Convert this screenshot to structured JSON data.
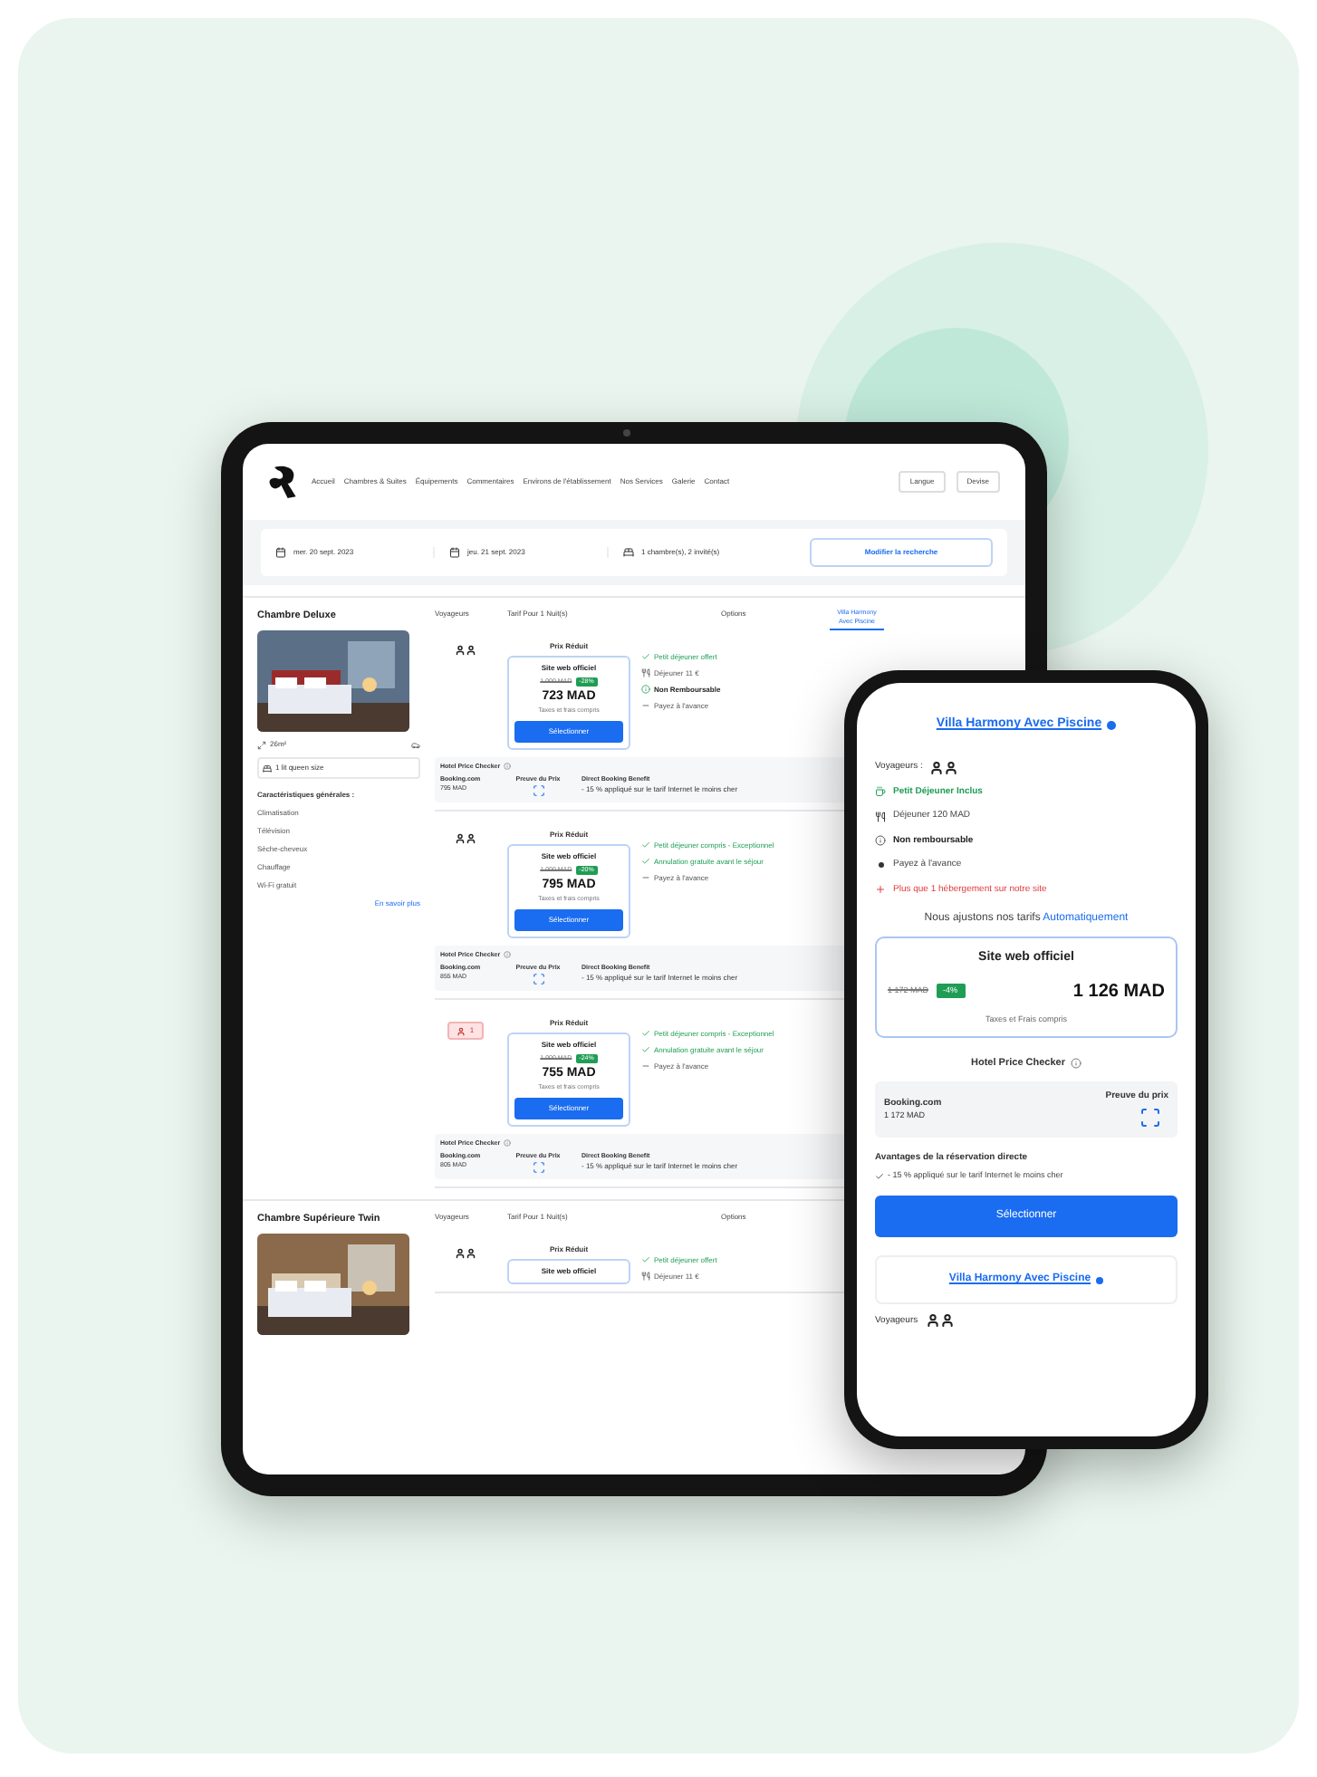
{
  "tablet": {
    "nav": [
      "Accueil",
      "Chambres & Suites",
      "Équipements",
      "Commentaires",
      "Environs de l'établissement",
      "Nos Services",
      "Galerie",
      "Contact"
    ],
    "header_buttons": [
      "Langue",
      "Devise"
    ],
    "search": {
      "check_in": "mer. 20 sept. 2023",
      "check_out": "jeu. 21 sept. 2023",
      "guests": "1 chambre(s), 2 invité(s)",
      "button": "Modifier la recherche"
    },
    "rooms": [
      {
        "name": "Chambre Deluxe",
        "size": "26m²",
        "beds": "1 lit queen size",
        "amenities_title": "Caractéristiques générales :",
        "amenities": [
          "Climatisation",
          "Télévision",
          "Sèche-cheveux",
          "Chauffage",
          "Wi-Fi gratuit"
        ],
        "more": "En savoir plus",
        "columns": [
          "Voyageurs",
          "Tarif Pour 1 Nuit(s)",
          "Options"
        ],
        "side_link": "Villa Harmony Avec Piscine",
        "rates": [
          {
            "guests": {
              "kind": "pair"
            },
            "label": "Prix Réduit",
            "site": "Site web officiel",
            "old_price": "1 000 MAD",
            "discount": "-28%",
            "price": "723 MAD",
            "taxes": "Taxes et frais compris",
            "button": "Sélectionner",
            "features": [
              {
                "kind": "offer",
                "text": "Petit déjeuner offert"
              },
              {
                "kind": "info",
                "text": "Déjeuner 11 €"
              },
              {
                "kind": "policy",
                "text": "Non Remboursable"
              },
              {
                "kind": "plain",
                "text": "Payez à l'avance"
              }
            ],
            "checker": {
              "title": "Hotel Price Checker",
              "site": "Booking.com",
              "site_price": "795 MAD",
              "proof": "Preuve du Prix",
              "benefit_title": "Direct Booking Benefit",
              "benefit": "- 15 % appliqué sur le tarif Internet le moins cher"
            }
          },
          {
            "guests": {
              "kind": "pair"
            },
            "label": "Prix Réduit",
            "site": "Site web officiel",
            "old_price": "1 000 MAD",
            "discount": "-20%",
            "price": "795 MAD",
            "taxes": "Taxes et frais compris",
            "button": "Sélectionner",
            "features": [
              {
                "kind": "offer",
                "text": "Petit déjeuner compris - Exceptionnel"
              },
              {
                "kind": "offer",
                "text": "Annulation gratuite avant le séjour"
              },
              {
                "kind": "plain",
                "text": "Payez à l'avance"
              }
            ],
            "checker": {
              "title": "Hotel Price Checker",
              "site": "Booking.com",
              "site_price": "855 MAD",
              "proof": "Preuve du Prix",
              "benefit_title": "Direct Booking Benefit",
              "benefit": "- 15 % appliqué sur le tarif Internet le moins cher"
            }
          },
          {
            "guests": {
              "kind": "single",
              "text": "1"
            },
            "label": "Prix Réduit",
            "site": "Site web officiel",
            "old_price": "1 000 MAD",
            "discount": "-24%",
            "price": "755 MAD",
            "taxes": "Taxes et frais compris",
            "button": "Sélectionner",
            "features": [
              {
                "kind": "offer",
                "text": "Petit déjeuner compris - Exceptionnel"
              },
              {
                "kind": "offer",
                "text": "Annulation gratuite avant le séjour"
              },
              {
                "kind": "plain",
                "text": "Payez à l'avance"
              }
            ],
            "checker": {
              "title": "Hotel Price Checker",
              "site": "Booking.com",
              "site_price": "805 MAD",
              "proof": "Preuve du Prix",
              "benefit_title": "Direct Booking Benefit",
              "benefit": "- 15 % appliqué sur le tarif Internet le moins cher"
            }
          }
        ]
      },
      {
        "name": "Chambre Supérieure Twin",
        "columns": [
          "Voyageurs",
          "Tarif Pour 1 Nuit(s)",
          "Options"
        ],
        "rates": [
          {
            "guests": {
              "kind": "pair"
            },
            "label": "Prix Réduit",
            "site": "Site web officiel",
            "features": [
              {
                "kind": "offer",
                "text": "Petit déjeuner offert"
              },
              {
                "kind": "info",
                "text": "Déjeuner 11 €"
              }
            ]
          }
        ]
      }
    ]
  },
  "phone": {
    "title": "Villa Harmony Avec Piscine",
    "guests_label": "Voyageurs :",
    "features": [
      {
        "kind": "breakfast",
        "text": "Petit Déjeuner Inclus"
      },
      {
        "kind": "lunch",
        "text": "Déjeuner 120 MAD"
      },
      {
        "kind": "refund",
        "text": "Non remboursable"
      },
      {
        "kind": "bullet",
        "text": "Payez à l'avance"
      },
      {
        "kind": "alert",
        "text": "Plus que 1 hébergement sur notre site"
      }
    ],
    "notice": "Nous ajustons nos tarifs",
    "notice_link": "Automatiquement",
    "offer": {
      "title": "Site web officiel",
      "old_price": "1 172 MAD",
      "discount": "-4%",
      "price": "1 126 MAD",
      "taxes": "Taxes et Frais compris"
    },
    "checker": {
      "title": "Hotel Price Checker",
      "site": "Booking.com",
      "site_price": "1 172 MAD",
      "proof": "Preuve du prix"
    },
    "benefits_title": "Avantages de la réservation directe",
    "benefits": [
      "- 15 % appliqué sur le tarif Internet le moins cher"
    ],
    "button": "Sélectionner",
    "next_title": "Villa Harmony Avec Piscine",
    "next_guests_label": "Voyageurs"
  }
}
